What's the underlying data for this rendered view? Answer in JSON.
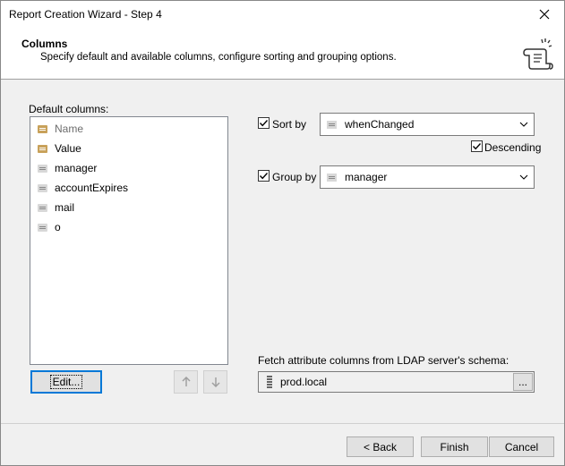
{
  "window": {
    "title": "Report Creation Wizard - Step 4"
  },
  "header": {
    "title": "Columns",
    "description": "Specify default and available columns, configure sorting and grouping options."
  },
  "default_columns": {
    "label": "Default columns:",
    "items": [
      {
        "label": "Name",
        "icon": "attribute-main-icon",
        "greyed": true
      },
      {
        "label": "Value",
        "icon": "attribute-main-icon",
        "greyed": false
      },
      {
        "label": "manager",
        "icon": "attribute-icon",
        "greyed": false
      },
      {
        "label": "accountExpires",
        "icon": "attribute-icon",
        "greyed": false
      },
      {
        "label": "mail",
        "icon": "attribute-icon",
        "greyed": false
      },
      {
        "label": "o",
        "icon": "attribute-icon",
        "greyed": false
      }
    ],
    "edit_label": "Edit...",
    "up_icon": "arrow-up-icon",
    "down_icon": "arrow-down-icon"
  },
  "sort": {
    "label": "Sort by",
    "checked": true,
    "value": "whenChanged"
  },
  "descending": {
    "label": "Descending",
    "checked": true
  },
  "group": {
    "label": "Group by",
    "checked": true,
    "value": "manager"
  },
  "ldap": {
    "label": "Fetch attribute columns from LDAP server's schema:",
    "server": "prod.local",
    "browse_label": "..."
  },
  "footer": {
    "back_label": "< Back",
    "finish_label": "Finish",
    "cancel_label": "Cancel"
  },
  "colors": {
    "accent": "#0078d7",
    "main_attr_icon": "#c8a15a"
  }
}
